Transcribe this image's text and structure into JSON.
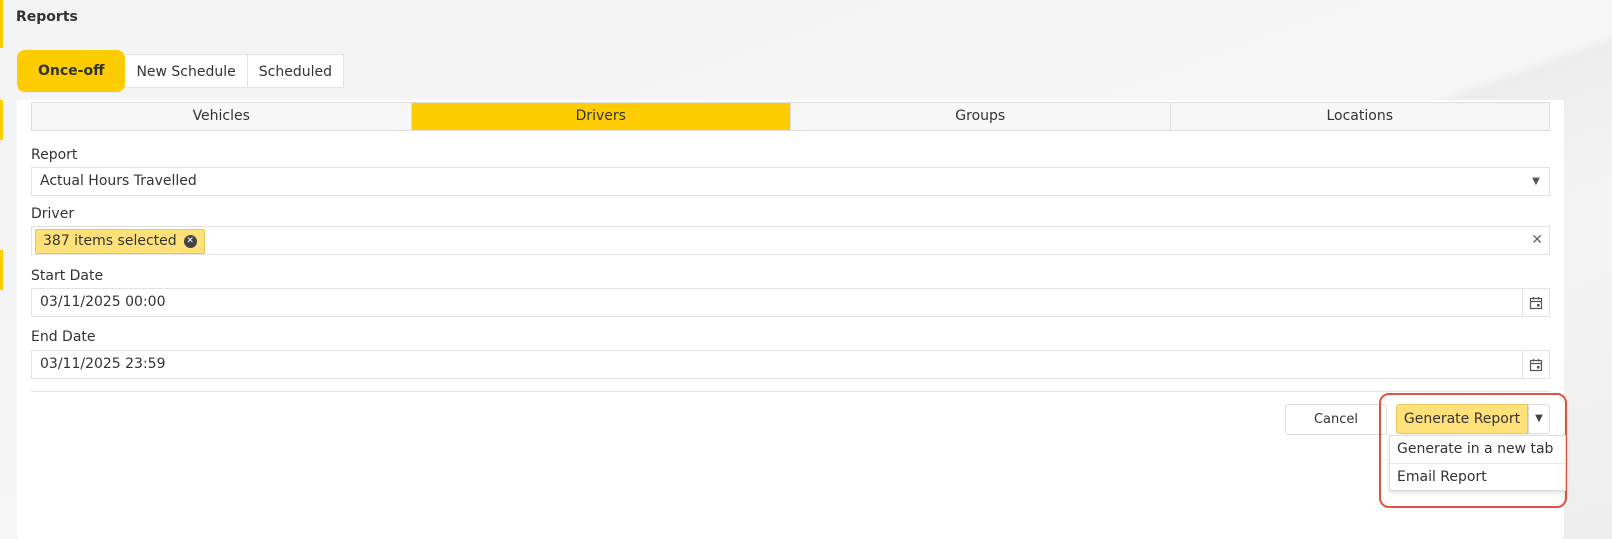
{
  "page": {
    "title": "Reports"
  },
  "top_tabs": [
    {
      "label": "Once-off",
      "active": true
    },
    {
      "label": "New Schedule",
      "active": false
    },
    {
      "label": "Scheduled",
      "active": false
    }
  ],
  "sub_tabs": [
    {
      "label": "Vehicles",
      "active": false
    },
    {
      "label": "Drivers",
      "active": true
    },
    {
      "label": "Groups",
      "active": false
    },
    {
      "label": "Locations",
      "active": false
    }
  ],
  "form": {
    "report": {
      "label": "Report",
      "value": "Actual Hours Travelled"
    },
    "driver": {
      "label": "Driver",
      "chip": "387 items selected"
    },
    "start_date": {
      "label": "Start Date",
      "value": "03/11/2025 00:00"
    },
    "end_date": {
      "label": "End Date",
      "value": "03/11/2025 23:59"
    }
  },
  "actions": {
    "cancel": "Cancel",
    "generate": "Generate Report",
    "menu": [
      "Generate in a new tab",
      "Email Report"
    ]
  },
  "colors": {
    "accent": "#ffcc00",
    "chip": "#ffe17a",
    "highlight": "#e25240"
  },
  "icons": {
    "dropdown": "chevron-down-icon",
    "clear": "close-icon",
    "calendar": "calendar-icon",
    "chip_remove": "remove-circle-icon"
  }
}
